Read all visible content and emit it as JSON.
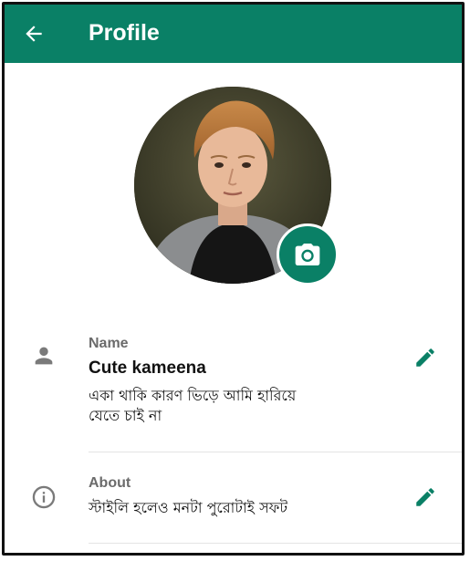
{
  "header": {
    "title": "Profile",
    "back_icon": "arrow-left-icon",
    "color": "#0a8066"
  },
  "avatar": {
    "description_icon": "profile-photo",
    "camera_icon": "camera-icon"
  },
  "name_section": {
    "icon": "person-icon",
    "label": "Name",
    "value": "Cute kameena",
    "subtitle_line1": "একা থাকি কারণ ভিড়ে আমি হারিয়ে",
    "subtitle_line2": "যেতে চাই না",
    "edit_icon": "pencil-icon"
  },
  "about_section": {
    "icon": "info-icon",
    "label": "About",
    "value": "স্টাইলি হলেও মনটা পুরোটাই সফট",
    "edit_icon": "pencil-icon"
  },
  "colors": {
    "accent": "#0a8066",
    "label_gray": "#6b6b6b",
    "icon_gray": "#7a7a7a"
  }
}
